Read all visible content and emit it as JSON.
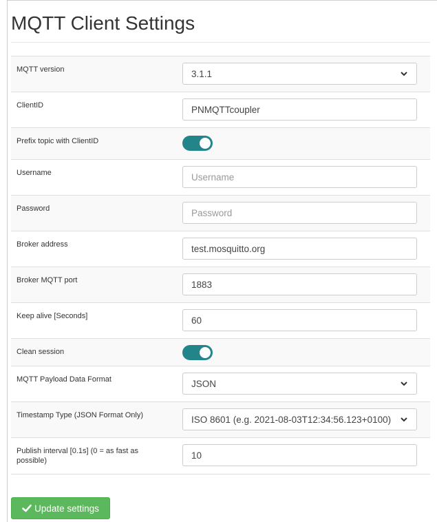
{
  "page": {
    "title": "MQTT Client Settings"
  },
  "rows": [
    {
      "label": "MQTT version",
      "type": "select",
      "value": "3.1.1"
    },
    {
      "label": "ClientID",
      "type": "input",
      "value": "PNMQTTcoupler"
    },
    {
      "label": "Prefix topic with ClientID",
      "type": "toggle",
      "state": "on"
    },
    {
      "label": "Username",
      "type": "input",
      "value": "",
      "placeholder": "Username"
    },
    {
      "label": "Password",
      "type": "input",
      "value": "",
      "placeholder": "Password"
    },
    {
      "label": "Broker address",
      "type": "input",
      "value": "test.mosquitto.org"
    },
    {
      "label": "Broker MQTT port",
      "type": "input",
      "value": "1883"
    },
    {
      "label": "Keep alive [Seconds]",
      "type": "input",
      "value": "60"
    },
    {
      "label": "Clean session",
      "type": "toggle",
      "state": "on"
    },
    {
      "label": "MQTT Payload Data Format",
      "type": "select",
      "value": "JSON"
    },
    {
      "label": "Timestamp Type (JSON Format Only)",
      "type": "select",
      "value": "ISO 8601 (e.g. 2021-08-03T12:34:56.123+0100)"
    },
    {
      "label": "Publish interval [0.1s] (0 = as fast as possible)",
      "type": "input",
      "value": "10"
    }
  ],
  "update_button": {
    "label": "Update settings",
    "icon": "checkmark-icon",
    "color": "#5cb85c"
  },
  "colors": {
    "toggle_on": "#23858a",
    "row_stripe": "#f9f9f9",
    "border": "#dddddd"
  }
}
